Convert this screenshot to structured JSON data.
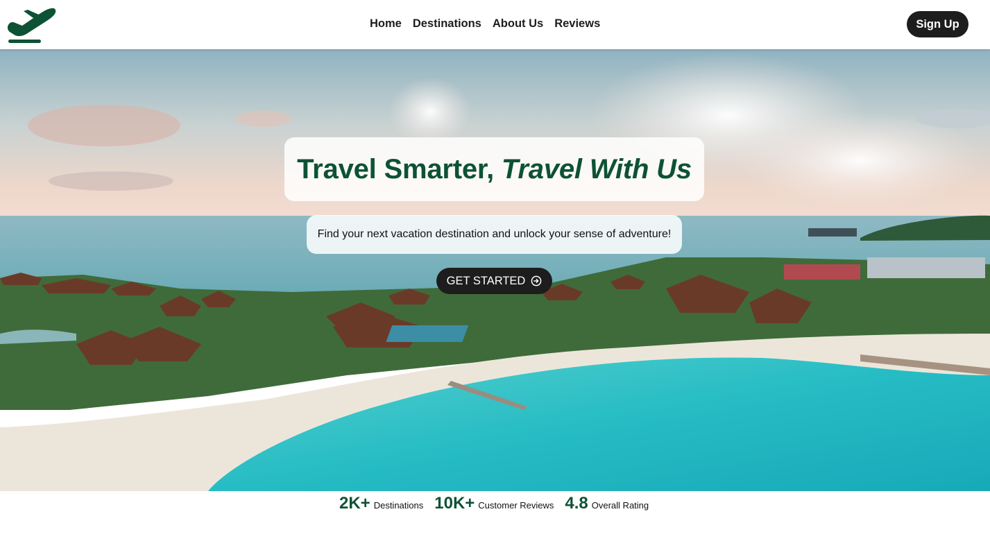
{
  "header": {
    "logo_icon": "airplane-takeoff-icon",
    "nav": [
      {
        "label": "Home"
      },
      {
        "label": "Destinations"
      },
      {
        "label": "About Us"
      },
      {
        "label": "Reviews"
      }
    ],
    "signup_label": "Sign Up"
  },
  "hero": {
    "background": "tropical-island-resort-photo",
    "headline_plain": "Travel Smarter, ",
    "headline_italic": "Travel With Us",
    "subtitle": "Find your next vacation destination and unlock your sense of adventure!",
    "cta_label": "GET STARTED",
    "cta_icon": "arrow-circle-right-icon"
  },
  "stats": [
    {
      "value": "2K+",
      "label": "Destinations"
    },
    {
      "value": "10K+",
      "label": "Customer Reviews"
    },
    {
      "value": "4.8",
      "label": "Overall Rating"
    }
  ],
  "colors": {
    "brand_green": "#0d5234",
    "dark_button": "#1d1d1d"
  }
}
